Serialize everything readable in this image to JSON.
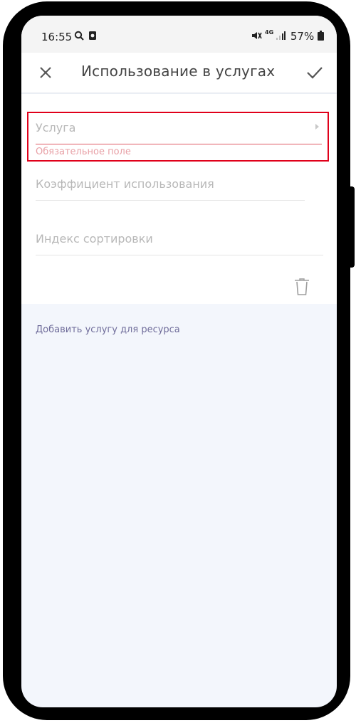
{
  "status_bar": {
    "time": "16:55",
    "battery": "57%",
    "network": "4G"
  },
  "app_bar": {
    "title": "Использование в услугах"
  },
  "form": {
    "service_label": "Услуга",
    "service_required_hint": "Обязательное поле",
    "coefficient_placeholder": "Коэффициент использования",
    "sort_index_placeholder": "Индекс сортировки"
  },
  "actions": {
    "add_service_link": "Добавить услугу для ресурса"
  },
  "colors": {
    "accent_link": "#6f6c9a",
    "error_line": "#e05a64",
    "highlight": "#e0001a",
    "background": "#f3f6fc"
  },
  "icons": {
    "close": "close-icon",
    "confirm": "check-icon",
    "delete": "trash-icon",
    "dropdown": "chevron-right-icon"
  }
}
